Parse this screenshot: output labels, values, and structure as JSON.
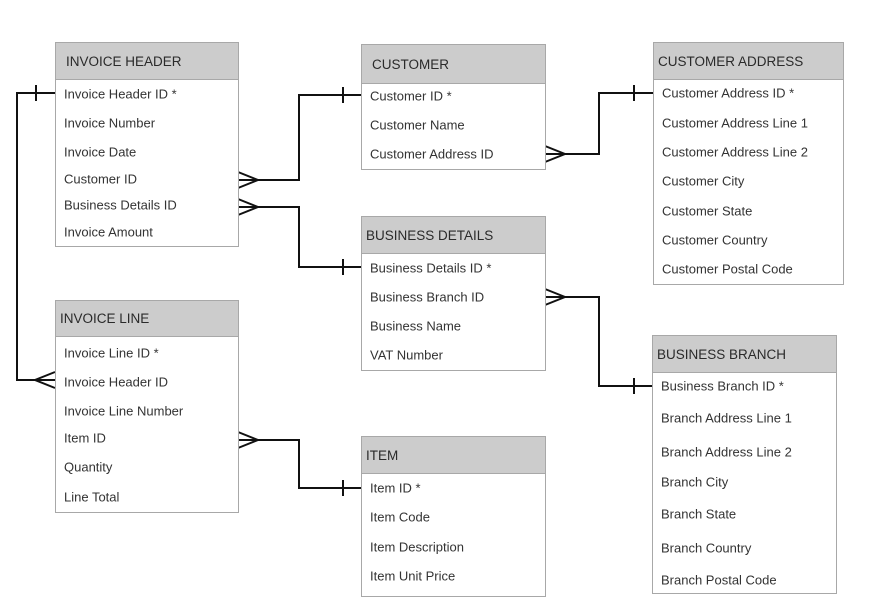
{
  "diagram": {
    "type": "entity-relationship",
    "entities": [
      {
        "id": "invoice-header",
        "title": "INVOICE HEADER",
        "fields": [
          "Invoice Header ID *",
          "Invoice Number",
          "Invoice Date",
          "Customer ID",
          "Business Details ID",
          "Invoice Amount"
        ]
      },
      {
        "id": "customer",
        "title": "CUSTOMER",
        "fields": [
          "Customer ID *",
          "Customer Name",
          "Customer Address ID"
        ]
      },
      {
        "id": "customer-address",
        "title": "CUSTOMER ADDRESS",
        "fields": [
          "Customer Address ID *",
          "Customer Address Line 1",
          "Customer Address Line 2",
          "Customer City",
          "Customer State",
          "Customer Country",
          "Customer Postal Code"
        ]
      },
      {
        "id": "business-details",
        "title": "BUSINESS DETAILS",
        "fields": [
          "Business Details ID *",
          "Business Branch ID",
          "Business Name",
          "VAT Number"
        ]
      },
      {
        "id": "invoice-line",
        "title": "INVOICE LINE",
        "fields": [
          "Invoice Line ID *",
          "Invoice Header ID",
          "Invoice Line Number",
          "Item ID",
          "Quantity",
          "Line Total"
        ]
      },
      {
        "id": "business-branch",
        "title": "BUSINESS BRANCH",
        "fields": [
          "Business Branch ID *",
          "Branch Address Line 1",
          "Branch Address Line 2",
          "Branch City",
          "Branch State",
          "Branch Country",
          "Branch Postal Code"
        ]
      },
      {
        "id": "item",
        "title": "ITEM",
        "fields": [
          "Item ID *",
          "Item Code",
          "Item Description",
          "Item Unit Price"
        ]
      }
    ],
    "relationships": [
      {
        "from": "Invoice Header.Customer ID",
        "to": "Customer.Customer ID *",
        "cardinality": "many-to-one"
      },
      {
        "from": "Invoice Header.Business Details ID",
        "to": "Business Details.Business Details ID *",
        "cardinality": "many-to-one"
      },
      {
        "from": "Customer.Customer Address ID",
        "to": "Customer Address.Customer Address ID *",
        "cardinality": "many-to-one"
      },
      {
        "from": "Business Details.Business Branch ID",
        "to": "Business Branch.Business Branch ID *",
        "cardinality": "many-to-one"
      },
      {
        "from": "Invoice Line.Invoice Header ID",
        "to": "Invoice Header.Invoice Header ID *",
        "cardinality": "many-to-one"
      },
      {
        "from": "Invoice Line.Item ID",
        "to": "Item.Item ID *",
        "cardinality": "many-to-one"
      }
    ]
  }
}
